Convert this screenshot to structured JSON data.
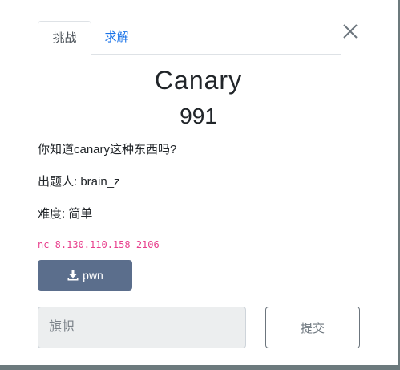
{
  "tabs": [
    {
      "label": "挑战",
      "active": true
    },
    {
      "label": "求解",
      "active": false
    }
  ],
  "challenge": {
    "name": "Canary",
    "score": "991",
    "description": "你知道canary这种东西吗?",
    "author_line": "出题人: brain_z",
    "difficulty_line": "难度: 简单",
    "connection": "nc 8.130.110.158 2106"
  },
  "download": {
    "label": "pwn",
    "icon": "download-icon"
  },
  "flag_form": {
    "placeholder": "旗帜",
    "value": "",
    "submit_label": "提交"
  },
  "colors": {
    "accent_tab": "#1a73e8",
    "download_button": "#5b6e8c",
    "code_text": "#e83e8c",
    "input_bg": "#eceeef"
  }
}
